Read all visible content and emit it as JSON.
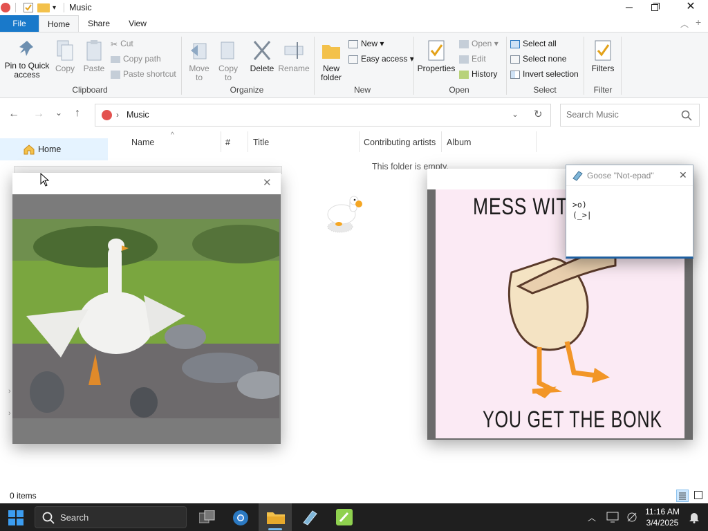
{
  "window": {
    "title": "Music"
  },
  "tabs": [
    {
      "label": "File"
    },
    {
      "label": "Home"
    },
    {
      "label": "Share"
    },
    {
      "label": "View"
    }
  ],
  "ribbon": {
    "clipboard": {
      "group": "Clipboard",
      "pin": "Pin to Quick access",
      "copy": "Copy",
      "paste": "Paste",
      "cut": "Cut",
      "copy_path": "Copy path",
      "paste_shortcut": "Paste shortcut"
    },
    "organize": {
      "group": "Organize",
      "move_to": "Move to",
      "copy_to": "Copy to",
      "delete": "Delete",
      "rename": "Rename"
    },
    "new": {
      "group": "New",
      "new_folder": "New folder",
      "new_item": "New",
      "easy_access": "Easy access"
    },
    "open": {
      "group": "Open",
      "properties": "Properties",
      "open": "Open",
      "edit": "Edit",
      "history": "History"
    },
    "select": {
      "group": "Select",
      "select_all": "Select all",
      "select_none": "Select none",
      "invert": "Invert selection"
    },
    "filter": {
      "group": "Filter",
      "filters": "Filters"
    }
  },
  "address": {
    "path": "Music",
    "search_placeholder": "Search Music"
  },
  "nav": {
    "home": "Home"
  },
  "columns": [
    "Name",
    "#",
    "Title",
    "Contributing artists",
    "Album"
  ],
  "empty_message": "This folder is empty.",
  "status": {
    "items": "0 items"
  },
  "meme": {
    "top": "MESS WITH",
    "bottom": "YOU GET THE BONK"
  },
  "notepad": {
    "title": "Goose \"Not-epad\"",
    "line1": ">o)",
    "line2": "(_>|"
  },
  "taskbar": {
    "search": "Search",
    "time": "11:16 AM",
    "date": "3/4/2025"
  },
  "colors": {
    "file_tab": "#1979ca",
    "taskbar": "#1f1f1f",
    "accent": "#0078d4",
    "goose_orange": "#f5a623"
  }
}
